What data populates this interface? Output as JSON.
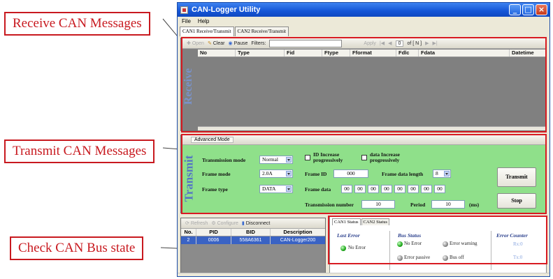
{
  "callouts": {
    "receive": "Receive CAN Messages",
    "transmit": "Transmit CAN Messages",
    "bus": "Check CAN Bus state"
  },
  "window": {
    "title": "CAN-Logger Utility",
    "menu": [
      "File",
      "Help"
    ],
    "tabs": [
      "CAN1 Receive/Transmit",
      "CAN2 Receive/Transmit"
    ]
  },
  "receive": {
    "side_label": "Receive",
    "toolbar": {
      "open": "Open",
      "clear": "Clear",
      "pause": "Pause",
      "filters": "Filters:",
      "apply": "Apply",
      "page": "of [ N ]"
    },
    "columns": [
      "No",
      "Type",
      "Fid",
      "Ftype",
      "Fformat",
      "Fdlc",
      "Fdata",
      "Datetime"
    ]
  },
  "transmit": {
    "side_label": "Transmit",
    "header": "Advanced Mode",
    "transmission_mode_label": "Transmission mode",
    "transmission_mode_value": "Normal",
    "frame_mode_label": "Frame mode",
    "frame_mode_value": "2.0A",
    "frame_type_label": "Frame type",
    "frame_type_value": "DATA",
    "id_increase": "ID Increase progressively",
    "data_increase": "data Increase progressively",
    "frame_id_label": "Frame ID",
    "frame_id_value": "000",
    "frame_data_length_label": "Frame data length",
    "frame_data_length_value": "8",
    "frame_data_label": "Frame data",
    "frame_data": [
      "00",
      "00",
      "00",
      "00",
      "00",
      "00",
      "00",
      "00"
    ],
    "transmission_number_label": "Transmission number",
    "transmission_number_value": "10",
    "period_label": "Period",
    "period_value": "10",
    "period_unit": "(ms)",
    "transmit_button": "Transmit",
    "stop_button": "Stop"
  },
  "devices": {
    "toolbar": {
      "refresh": "Refresh",
      "configure": "Configure",
      "disconnect": "Disconnect"
    },
    "columns": [
      "No.",
      "PID",
      "BID",
      "Description"
    ],
    "rows": [
      {
        "no": "2",
        "pid": "0006",
        "bid": "558A6361",
        "description": "CAN-Logger200"
      }
    ]
  },
  "bus_status": {
    "tabs": [
      "CAN1 Status",
      "CAN2 Status"
    ],
    "last_error_title": "Last Error",
    "last_error_value": "No Error",
    "bus_status_title": "Bus Status",
    "states": [
      "No Error",
      "Error warning",
      "Error passive",
      "Bus off"
    ],
    "error_counter_title": "Error Counter",
    "rx": "Rx:0",
    "tx": "Tx:0"
  }
}
